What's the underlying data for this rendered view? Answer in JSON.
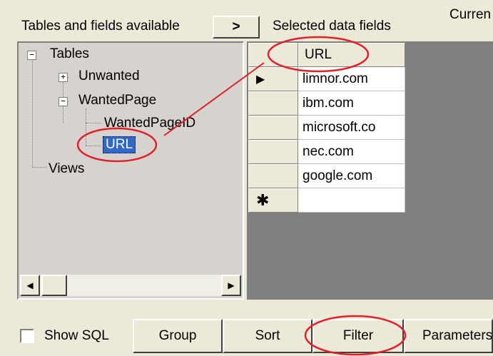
{
  "header": {
    "available_label": "Tables and fields available",
    "move_button": ">",
    "selected_label": "Selected data fields",
    "current_label": "Curren"
  },
  "tree": {
    "root": "Tables",
    "unwanted": "Unwanted",
    "wantedpage": "WantedPage",
    "wantedpageid": "WantedPageID",
    "url": "URL",
    "views": "Views"
  },
  "grid": {
    "column": "URL",
    "current_row_marker": "▶",
    "new_row_marker": "✱",
    "rows": [
      "limnor.com",
      "ibm.com",
      "microsoft.co",
      "nec.com",
      "google.com"
    ]
  },
  "footer": {
    "show_sql": "Show SQL",
    "group": "Group",
    "sort": "Sort",
    "filter": "Filter",
    "parameters": "Parameters"
  },
  "annotation_color": "#e0202a"
}
